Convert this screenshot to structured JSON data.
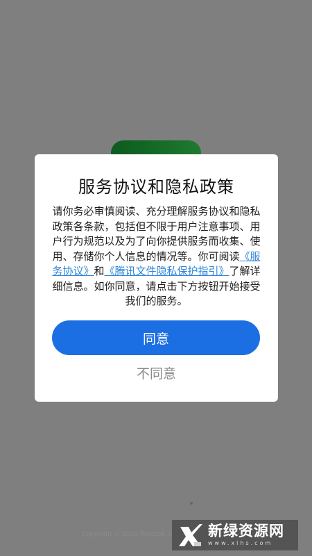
{
  "background": {
    "copyright": "Copyright © 2010 Tencent. All Rights Reserved."
  },
  "dialog": {
    "title": "服务协议和隐私政策",
    "body": {
      "intro": "请你务必审慎阅读、充分理解服务协议和隐私政策各条款，包括但不限于用户注意事项、用户行为规范以及为了向你提供服务而收集、使用、存储你个人信息的情况等。你可阅读",
      "link_service": "《服务协议》",
      "and": "和",
      "link_privacy": "《腾讯文件隐私保护指引》",
      "outro": "了解详细信息。如你同意，请点击下方按钮开始接受我们的服务。"
    },
    "agree_label": "同意",
    "disagree_label": "不同意"
  },
  "watermark": {
    "title": "新绿资源网",
    "subtitle": "www.xlhs.com"
  },
  "colors": {
    "overlay": "#7f7f7f",
    "primary": "#1c6fe2",
    "link": "#2f86d8"
  }
}
